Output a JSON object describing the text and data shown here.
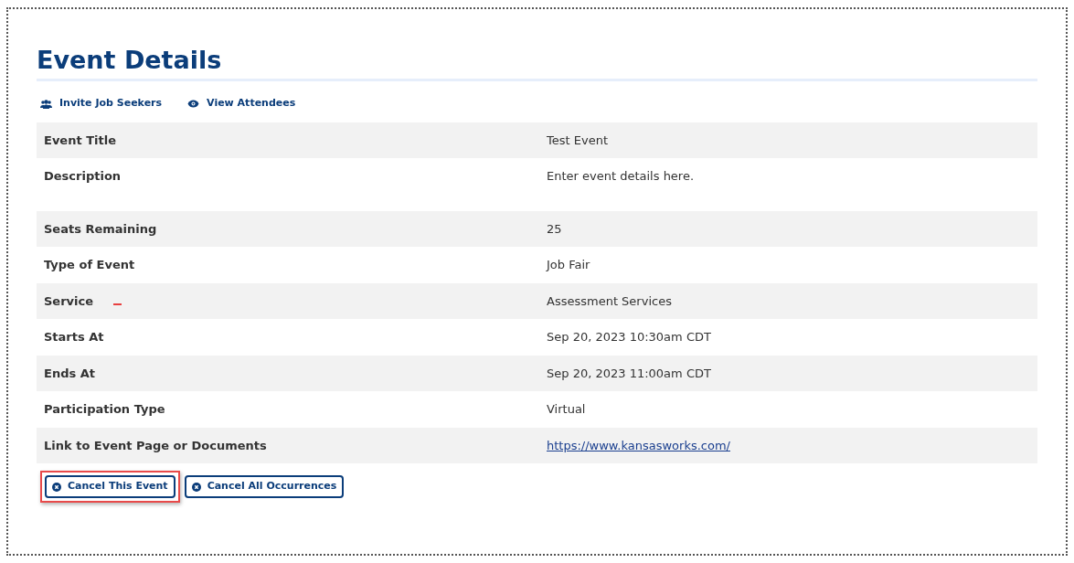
{
  "title": "Event Details",
  "actions": [
    {
      "label": "Invite Job Seekers",
      "kind": "people"
    },
    {
      "label": "View Attendees",
      "kind": "eye"
    }
  ],
  "rows": [
    {
      "label": "Event Title",
      "value": "Test Event",
      "kind": "text",
      "marked": false
    },
    {
      "label": "Description",
      "value": "Enter event details here.",
      "kind": "tall",
      "marked": false
    },
    {
      "label": "Seats Remaining",
      "value": "25",
      "kind": "text",
      "marked": false
    },
    {
      "label": "Type of Event",
      "value": "Job Fair",
      "kind": "text",
      "marked": false
    },
    {
      "label": "Service",
      "value": "Assessment Services",
      "kind": "text",
      "marked": true
    },
    {
      "label": "Starts At",
      "value": "Sep 20, 2023 10:30am CDT",
      "kind": "text",
      "marked": false
    },
    {
      "label": "Ends At",
      "value": "Sep 20, 2023 11:00am CDT",
      "kind": "text",
      "marked": false
    },
    {
      "label": "Participation Type",
      "value": "Virtual",
      "kind": "text",
      "marked": false
    },
    {
      "label": "Link to Event Page or Documents",
      "value": "https://www.kansasworks.com/",
      "kind": "link",
      "marked": false
    }
  ],
  "buttons": [
    {
      "label": "Cancel This Event",
      "highlighted": true
    },
    {
      "label": "Cancel All Occurrences",
      "highlighted": false
    }
  ]
}
